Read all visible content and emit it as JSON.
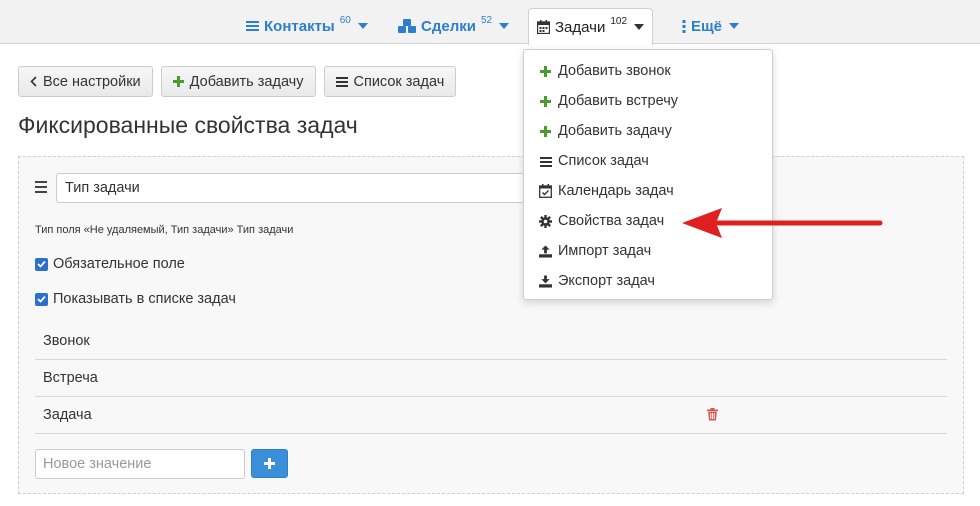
{
  "nav": {
    "tabs": [
      {
        "label": "Контакты",
        "count": "60",
        "icon": "list-icon"
      },
      {
        "label": "Сделки",
        "count": "52",
        "icon": "cubes-icon"
      },
      {
        "label": "Задачи",
        "count": "102",
        "icon": "calendar-icon"
      },
      {
        "label": "Ещё",
        "icon": "vertical-ellipsis-icon"
      }
    ],
    "active_tab": "Задачи"
  },
  "toolbar": {
    "all_settings": "Все настройки",
    "add_task": "Добавить задачу",
    "task_list": "Список задач"
  },
  "page": {
    "title": "Фиксированные свойства задач"
  },
  "field": {
    "name_value": "Тип задачи",
    "hint": "Тип поля «Не удаляемый, Тип задачи» Тип задачи",
    "required_label": "Обязательное поле",
    "required_checked": true,
    "show_in_list_label": "Показывать в списке задач",
    "show_in_list_checked": true,
    "values": [
      "Звонок",
      "Встреча",
      "Задача"
    ],
    "new_value_placeholder": "Новое значение"
  },
  "dropdown": {
    "items": [
      {
        "label": "Добавить звонок",
        "icon": "plus-icon"
      },
      {
        "label": "Добавить встречу",
        "icon": "plus-icon"
      },
      {
        "label": "Добавить задачу",
        "icon": "plus-icon"
      },
      {
        "label": "Список задач",
        "icon": "list-icon"
      },
      {
        "label": "Календарь задач",
        "icon": "calendar-check-icon"
      },
      {
        "label": "Свойства задач",
        "icon": "gear-icon"
      },
      {
        "label": "Импорт задач",
        "icon": "upload-icon"
      },
      {
        "label": "Экспорт задач",
        "icon": "download-icon"
      }
    ]
  },
  "colors": {
    "nav_link": "#2c7ecf",
    "plus_green": "#4a9a2e",
    "primary_button": "#3a8fd8",
    "checkbox": "#2c6fd1",
    "delete": "#d9534f",
    "annotation_arrow": "#e02020"
  }
}
